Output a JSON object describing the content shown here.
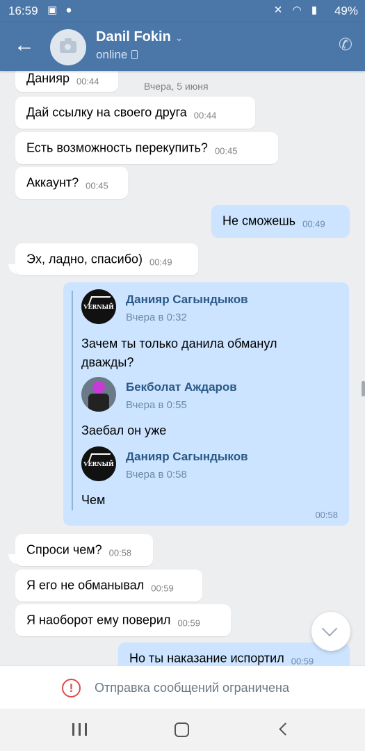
{
  "status_bar": {
    "time": "16:59",
    "battery": "49%",
    "left_icons": "▣ ●",
    "right_icons": "✕ ◠ ▮"
  },
  "header": {
    "back_icon": "arrow-left-icon",
    "name": "Danil Fokin",
    "status": "online"
  },
  "date_separator": "Вчера, 5 июня",
  "messages": [
    {
      "text": "Данияр",
      "time": "00:44"
    },
    {
      "text": "Дай ссылку на своего друга",
      "time": "00:44"
    },
    {
      "text": "Есть возможность перекупить?",
      "time": "00:45"
    },
    {
      "text": "Аккаунт?",
      "time": "00:45"
    },
    {
      "text": "Не сможешь",
      "time": "00:49"
    },
    {
      "text": "Эх, ладно, спасибо)",
      "time": "00:49"
    },
    {
      "text": "Спроси чем?",
      "time": "00:58"
    },
    {
      "text": "Я его не обманывал",
      "time": "00:59"
    },
    {
      "text": "Я наоборот ему поверил",
      "time": "00:59"
    },
    {
      "text": "Но ты наказание испортил",
      "time": "00:59"
    }
  ],
  "forwarded": {
    "time": "00:58",
    "items": [
      {
        "author": "Данияр Сагындыков",
        "date": "Вчера в 0:32",
        "text": "Зачем ты только данила обманул дважды?",
        "avatar_text": "VERNЫЙ"
      },
      {
        "author": "Бекболат Аждаров",
        "date": "Вчера в 0:55",
        "text": "Заебал он уже"
      },
      {
        "author": "Данияр Сагындыков",
        "date": "Вчера в 0:58",
        "text": "Чем",
        "avatar_text": "VERNЫЙ"
      }
    ]
  },
  "restriction": {
    "text": "Отправка сообщений ограничена"
  },
  "colors": {
    "header": "#4a76a8",
    "outgoing": "#cce4ff",
    "incoming": "#ffffff",
    "background": "#edeef0",
    "alert": "#e64646"
  }
}
